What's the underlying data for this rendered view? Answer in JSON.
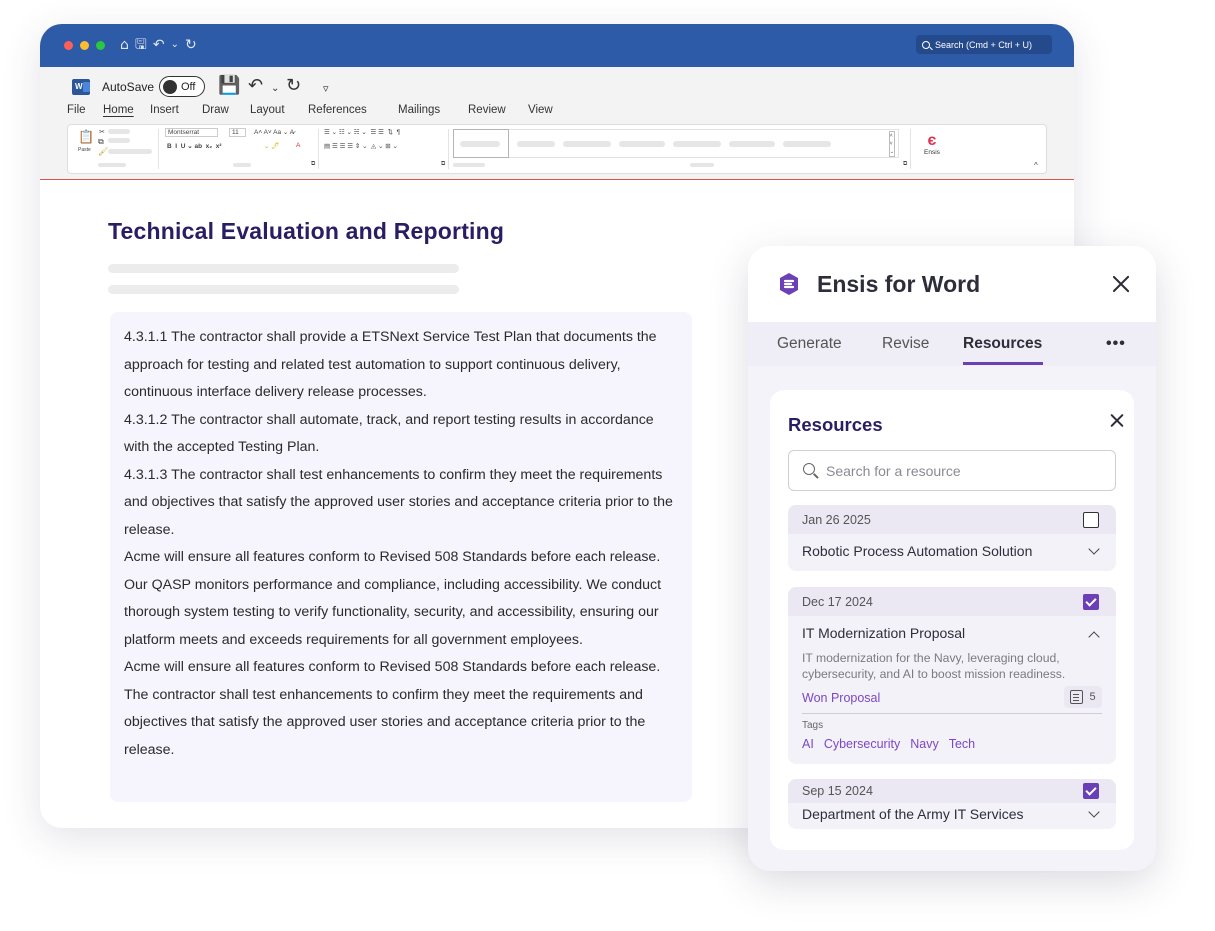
{
  "word": {
    "traffic_colors": [
      "#ff5f57",
      "#febc2e",
      "#28c840"
    ],
    "titlebar_icons": [
      "⌂",
      "🖫",
      "↶",
      "⌄",
      "↻"
    ],
    "search_label": "Search (Cmd + Ctrl + U)",
    "logo_letter": "W",
    "autosave_label": "AutoSave",
    "autosave_toggle": "Off",
    "menu": [
      "File",
      "Home",
      "Insert",
      "Draw",
      "Layout",
      "References",
      "Mailings",
      "Review",
      "View"
    ],
    "active_menu": "Home",
    "ribbon": {
      "paste_label": "Paste",
      "font_name": "Montserrat",
      "font_size": "11",
      "ensis_label": "Ensis",
      "collapse_label": "^"
    }
  },
  "document": {
    "title": "Technical Evaluation and Reporting",
    "paragraphs": [
      "4.3.1.1 The contractor shall provide a ETSNext Service Test Plan that documents the approach for testing and related test automation to support continuous delivery, continuous interface delivery release processes.",
      "4.3.1.2 The contractor shall automate, track, and report testing results in accordance with the accepted Testing Plan.",
      "4.3.1.3 The contractor shall test enhancements to confirm they meet the requirements and objectives that satisfy the approved user stories and acceptance criteria prior to the release.",
      "Acme will ensure all features conform to Revised 508 Standards before each release. Our QASP monitors performance and compliance, including accessibility. We conduct thorough system testing to verify functionality, security, and accessibility, ensuring our platform meets and exceeds requirements for all government employees.",
      "Acme will ensure all features conform to Revised 508 Standards before each release. The contractor shall test enhancements to confirm they meet the requirements and objectives that satisfy the approved user stories and acceptance criteria prior to the release."
    ]
  },
  "panel": {
    "title": "Ensis for Word",
    "brand_color": "#6b3fb5",
    "tabs": [
      "Generate",
      "Revise",
      "Resources"
    ],
    "active_tab": "Resources",
    "more_label": "•••",
    "resources": {
      "title": "Resources",
      "search_placeholder": "Search for a resource",
      "items": [
        {
          "date": "Jan 26 2025",
          "name": "Robotic Process Automation Solution",
          "checked": false,
          "expanded": false
        },
        {
          "date": "Dec 17 2024",
          "name": "IT Modernization Proposal",
          "checked": true,
          "expanded": true,
          "description": "IT modernization for the Navy, leveraging cloud, cybersecurity, and AI to boost mission readiness.",
          "status": "Won Proposal",
          "doc_count": "5",
          "tags_label": "Tags",
          "tags": [
            "AI",
            "Cybersecurity",
            "Navy",
            "Tech"
          ]
        },
        {
          "date": "Sep 15 2024",
          "name": "Department of the Army IT Services",
          "checked": true,
          "expanded": false
        }
      ]
    }
  }
}
